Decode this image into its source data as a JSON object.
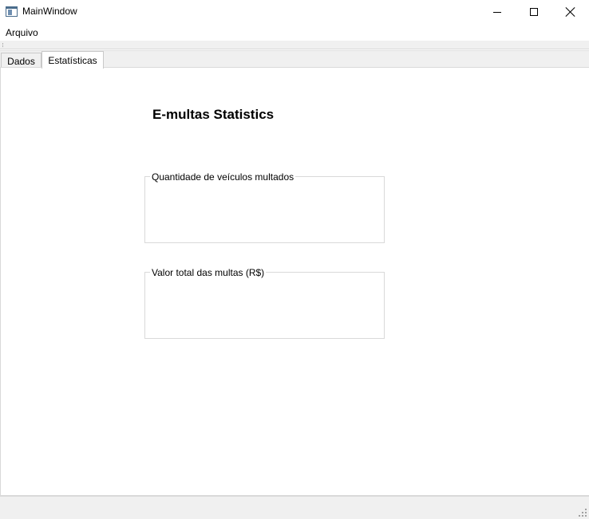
{
  "window": {
    "title": "MainWindow"
  },
  "menubar": {
    "items": [
      {
        "label": "Arquivo"
      }
    ]
  },
  "tabs": [
    {
      "label": "Dados",
      "active": false
    },
    {
      "label": "Estatísticas",
      "active": true
    }
  ],
  "statistics": {
    "heading": "E-multas Statistics",
    "groups": [
      {
        "title": "Quantidade de veículos multados"
      },
      {
        "title": "Valor total das multas (R$)"
      }
    ]
  }
}
